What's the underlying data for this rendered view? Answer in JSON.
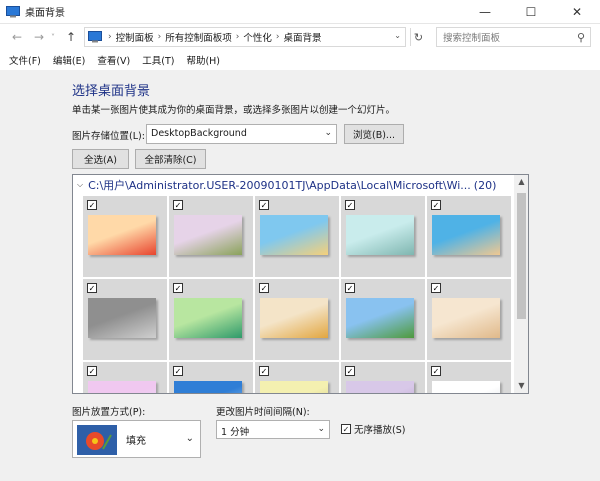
{
  "window": {
    "title": "桌面背景",
    "buttons": [
      "minimize",
      "maximize",
      "close"
    ]
  },
  "address": {
    "breadcrumbs": [
      "控制面板",
      "所有控制面板项",
      "个性化",
      "桌面背景"
    ],
    "search_placeholder": "搜索控制面板"
  },
  "menu": [
    "文件(F)",
    "编辑(E)",
    "查看(V)",
    "工具(T)",
    "帮助(H)"
  ],
  "main": {
    "heading": "选择桌面背景",
    "subtitle": "单击某一张图片使其成为你的桌面背景，或选择多张图片以创建一个幻灯片。",
    "location_label": "图片存储位置(L):",
    "location_value": "DesktopBackground",
    "browse_label": "浏览(B)...",
    "select_all_label": "全选(A)",
    "clear_all_label": "全部清除(C)",
    "folder_path": "C:\\用户\\Administrator.USER-20090101TJ\\AppData\\Local\\Microsoft\\Wi...",
    "folder_count": "(20)",
    "tiles": [
      {
        "colors": [
          "#ffd9a8",
          "#e8442e"
        ],
        "checked": true
      },
      {
        "colors": [
          "#e6d3e8",
          "#8aa25a"
        ],
        "checked": true
      },
      {
        "colors": [
          "#7fc8ef",
          "#f5d07a"
        ],
        "checked": true
      },
      {
        "colors": [
          "#c9ecec",
          "#7fb6b0"
        ],
        "checked": true
      },
      {
        "colors": [
          "#4fb2e6",
          "#f0c891"
        ],
        "checked": true
      },
      {
        "colors": [
          "#8f8f8f",
          "#cfcfcf"
        ],
        "checked": true
      },
      {
        "colors": [
          "#b8e6a0",
          "#2e9a6a"
        ],
        "checked": true
      },
      {
        "colors": [
          "#f4e4c8",
          "#e2a640"
        ],
        "checked": true
      },
      {
        "colors": [
          "#89c2f0",
          "#4e9a3c"
        ],
        "checked": true
      },
      {
        "colors": [
          "#f6e6d0",
          "#e0b98a"
        ],
        "checked": true
      },
      {
        "colors": [
          "#f0c8f0",
          "#e8e0f8"
        ],
        "checked": true
      },
      {
        "colors": [
          "#2f7ed6",
          "#bcdcf6"
        ],
        "checked": true
      },
      {
        "colors": [
          "#f4f0b0",
          "#c8c07a"
        ],
        "checked": true
      },
      {
        "colors": [
          "#d8c8e8",
          "#b098c8"
        ],
        "checked": true
      },
      {
        "colors": [
          "#ffffff",
          "#c8d0d8"
        ],
        "checked": true
      }
    ],
    "position_label": "图片放置方式(P):",
    "position_value": "填充",
    "interval_label": "更改图片时间间隔(N):",
    "interval_value": "1 分钟",
    "shuffle_label": "无序播放(S)",
    "shuffle_checked": true
  },
  "colors": {
    "heading": "#1e3287",
    "content_bg": "#f0f0f0"
  }
}
